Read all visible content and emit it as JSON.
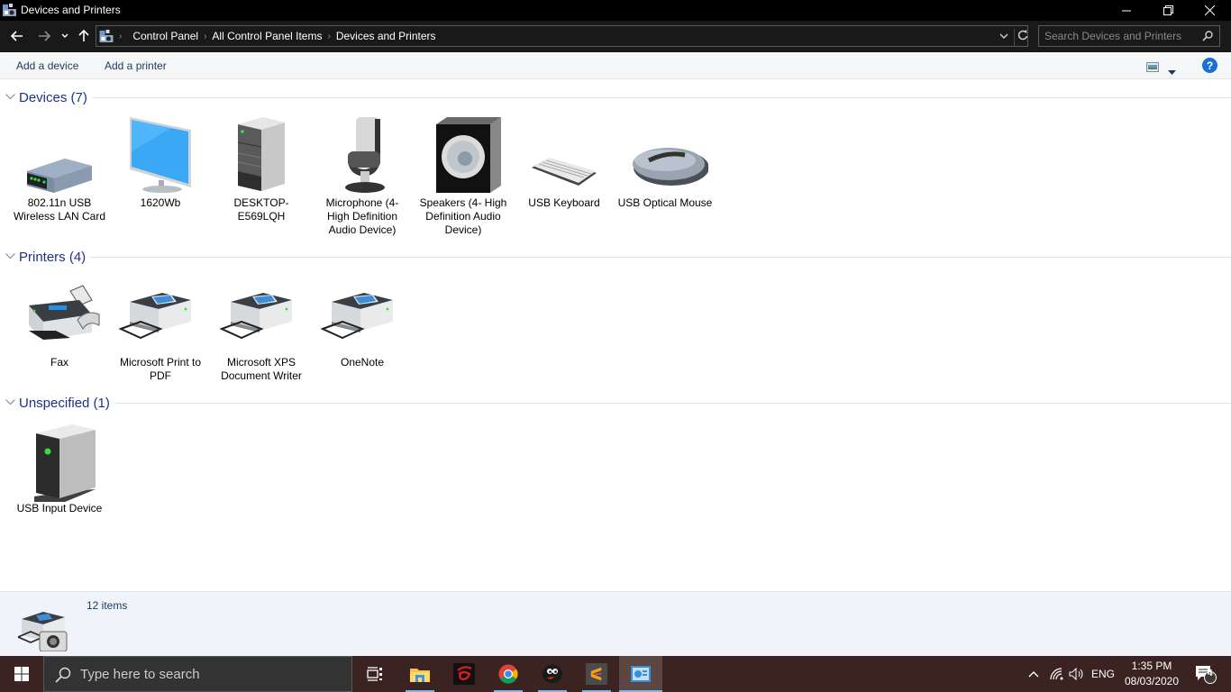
{
  "window": {
    "title": "Devices and Printers",
    "controls": {
      "minimize": "minimize",
      "restore": "restore",
      "close": "close"
    }
  },
  "address_bar": {
    "breadcrumbs": [
      "Control Panel",
      "All Control Panel Items",
      "Devices and Printers"
    ],
    "search_placeholder": "Search Devices and Printers"
  },
  "command_bar": {
    "add_device": "Add a device",
    "add_printer": "Add a printer"
  },
  "groups": [
    {
      "title": "Devices (7)",
      "items": [
        {
          "label": "802.11n USB Wireless LAN Card",
          "icon": "wireless-adapter-icon"
        },
        {
          "label": "1620Wb",
          "icon": "monitor-icon"
        },
        {
          "label": "DESKTOP-E569LQH",
          "icon": "computer-tower-icon"
        },
        {
          "label": "Microphone (4- High Definition Audio Device)",
          "icon": "microphone-icon"
        },
        {
          "label": "Speakers (4- High Definition Audio Device)",
          "icon": "speaker-icon"
        },
        {
          "label": "USB Keyboard",
          "icon": "keyboard-icon"
        },
        {
          "label": "USB Optical Mouse",
          "icon": "mouse-icon"
        }
      ]
    },
    {
      "title": "Printers (4)",
      "items": [
        {
          "label": "Fax",
          "icon": "fax-icon"
        },
        {
          "label": "Microsoft Print to PDF",
          "icon": "printer-icon"
        },
        {
          "label": "Microsoft XPS Document Writer",
          "icon": "printer-icon"
        },
        {
          "label": "OneNote",
          "icon": "printer-icon"
        }
      ]
    },
    {
      "title": "Unspecified (1)",
      "items": [
        {
          "label": "USB Input Device",
          "icon": "usb-device-icon"
        }
      ]
    }
  ],
  "status_bar": {
    "count": "12 items"
  },
  "taskbar": {
    "search_placeholder": "Type here to search",
    "apps": [
      "Task View",
      "File Explorer",
      "Garena",
      "Google Chrome",
      "Game App",
      "Sublime Text",
      "Control Panel"
    ],
    "tray": {
      "language": "ENG",
      "time": "1:35 PM",
      "date": "08/03/2020",
      "notifications": "4"
    }
  },
  "colors": {
    "accent": "#1e3287",
    "titlebar": "#000000",
    "addressbar": "#191919",
    "taskbar": "#3a2320",
    "help": "#1a6fd1"
  }
}
